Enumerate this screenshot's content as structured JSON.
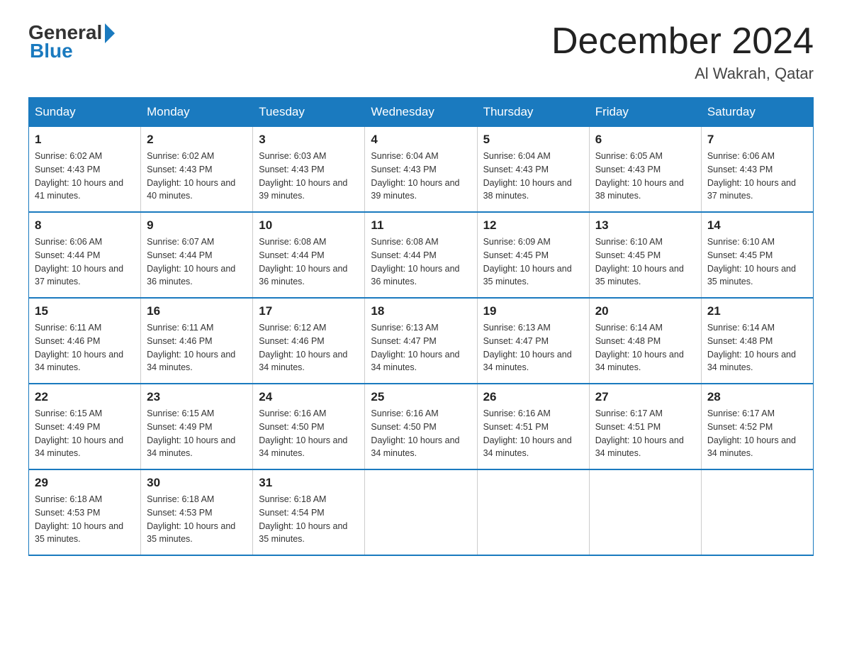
{
  "logo": {
    "general": "General",
    "blue": "Blue"
  },
  "title": "December 2024",
  "location": "Al Wakrah, Qatar",
  "days_of_week": [
    "Sunday",
    "Monday",
    "Tuesday",
    "Wednesday",
    "Thursday",
    "Friday",
    "Saturday"
  ],
  "weeks": [
    [
      {
        "day": 1,
        "sunrise": "6:02 AM",
        "sunset": "4:43 PM",
        "daylight": "10 hours and 41 minutes."
      },
      {
        "day": 2,
        "sunrise": "6:02 AM",
        "sunset": "4:43 PM",
        "daylight": "10 hours and 40 minutes."
      },
      {
        "day": 3,
        "sunrise": "6:03 AM",
        "sunset": "4:43 PM",
        "daylight": "10 hours and 39 minutes."
      },
      {
        "day": 4,
        "sunrise": "6:04 AM",
        "sunset": "4:43 PM",
        "daylight": "10 hours and 39 minutes."
      },
      {
        "day": 5,
        "sunrise": "6:04 AM",
        "sunset": "4:43 PM",
        "daylight": "10 hours and 38 minutes."
      },
      {
        "day": 6,
        "sunrise": "6:05 AM",
        "sunset": "4:43 PM",
        "daylight": "10 hours and 38 minutes."
      },
      {
        "day": 7,
        "sunrise": "6:06 AM",
        "sunset": "4:43 PM",
        "daylight": "10 hours and 37 minutes."
      }
    ],
    [
      {
        "day": 8,
        "sunrise": "6:06 AM",
        "sunset": "4:44 PM",
        "daylight": "10 hours and 37 minutes."
      },
      {
        "day": 9,
        "sunrise": "6:07 AM",
        "sunset": "4:44 PM",
        "daylight": "10 hours and 36 minutes."
      },
      {
        "day": 10,
        "sunrise": "6:08 AM",
        "sunset": "4:44 PM",
        "daylight": "10 hours and 36 minutes."
      },
      {
        "day": 11,
        "sunrise": "6:08 AM",
        "sunset": "4:44 PM",
        "daylight": "10 hours and 36 minutes."
      },
      {
        "day": 12,
        "sunrise": "6:09 AM",
        "sunset": "4:45 PM",
        "daylight": "10 hours and 35 minutes."
      },
      {
        "day": 13,
        "sunrise": "6:10 AM",
        "sunset": "4:45 PM",
        "daylight": "10 hours and 35 minutes."
      },
      {
        "day": 14,
        "sunrise": "6:10 AM",
        "sunset": "4:45 PM",
        "daylight": "10 hours and 35 minutes."
      }
    ],
    [
      {
        "day": 15,
        "sunrise": "6:11 AM",
        "sunset": "4:46 PM",
        "daylight": "10 hours and 34 minutes."
      },
      {
        "day": 16,
        "sunrise": "6:11 AM",
        "sunset": "4:46 PM",
        "daylight": "10 hours and 34 minutes."
      },
      {
        "day": 17,
        "sunrise": "6:12 AM",
        "sunset": "4:46 PM",
        "daylight": "10 hours and 34 minutes."
      },
      {
        "day": 18,
        "sunrise": "6:13 AM",
        "sunset": "4:47 PM",
        "daylight": "10 hours and 34 minutes."
      },
      {
        "day": 19,
        "sunrise": "6:13 AM",
        "sunset": "4:47 PM",
        "daylight": "10 hours and 34 minutes."
      },
      {
        "day": 20,
        "sunrise": "6:14 AM",
        "sunset": "4:48 PM",
        "daylight": "10 hours and 34 minutes."
      },
      {
        "day": 21,
        "sunrise": "6:14 AM",
        "sunset": "4:48 PM",
        "daylight": "10 hours and 34 minutes."
      }
    ],
    [
      {
        "day": 22,
        "sunrise": "6:15 AM",
        "sunset": "4:49 PM",
        "daylight": "10 hours and 34 minutes."
      },
      {
        "day": 23,
        "sunrise": "6:15 AM",
        "sunset": "4:49 PM",
        "daylight": "10 hours and 34 minutes."
      },
      {
        "day": 24,
        "sunrise": "6:16 AM",
        "sunset": "4:50 PM",
        "daylight": "10 hours and 34 minutes."
      },
      {
        "day": 25,
        "sunrise": "6:16 AM",
        "sunset": "4:50 PM",
        "daylight": "10 hours and 34 minutes."
      },
      {
        "day": 26,
        "sunrise": "6:16 AM",
        "sunset": "4:51 PM",
        "daylight": "10 hours and 34 minutes."
      },
      {
        "day": 27,
        "sunrise": "6:17 AM",
        "sunset": "4:51 PM",
        "daylight": "10 hours and 34 minutes."
      },
      {
        "day": 28,
        "sunrise": "6:17 AM",
        "sunset": "4:52 PM",
        "daylight": "10 hours and 34 minutes."
      }
    ],
    [
      {
        "day": 29,
        "sunrise": "6:18 AM",
        "sunset": "4:53 PM",
        "daylight": "10 hours and 35 minutes."
      },
      {
        "day": 30,
        "sunrise": "6:18 AM",
        "sunset": "4:53 PM",
        "daylight": "10 hours and 35 minutes."
      },
      {
        "day": 31,
        "sunrise": "6:18 AM",
        "sunset": "4:54 PM",
        "daylight": "10 hours and 35 minutes."
      },
      null,
      null,
      null,
      null
    ]
  ]
}
